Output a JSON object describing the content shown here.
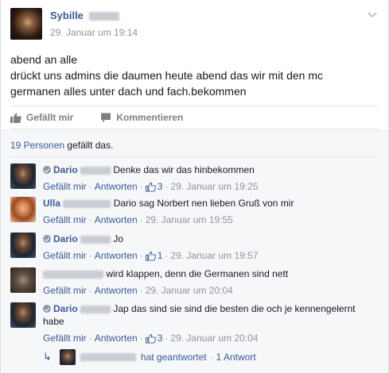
{
  "post": {
    "author_first": "Sybille",
    "time": "29. Januar um 19:14",
    "text": "abend an alle\ndrückt uns admins die daumen heute abend das wir mit den mc\ngermanen alles unter dach und fach.bekommen",
    "menu_icon": "chevron-down-icon"
  },
  "actions": {
    "like_label": "Gefällt mir",
    "comment_label": "Kommentieren"
  },
  "likes": {
    "count_link": "19 Personen",
    "suffix": " gefällt das."
  },
  "meta_labels": {
    "like": "Gefällt mir",
    "reply": "Antworten"
  },
  "comments": [
    {
      "name": "Dario",
      "moderator": true,
      "text": "Denke das wir das hinbekommen",
      "likes": "3",
      "time": "29. Januar um 19:25"
    },
    {
      "name": "Ulla",
      "moderator": false,
      "text": "Dario sag Norbert nen lieben Gruß von mir",
      "likes": "",
      "time": "29. Januar um 19:55"
    },
    {
      "name": "Dario",
      "moderator": true,
      "text": "Jo",
      "likes": "1",
      "time": "29. Januar um 19:57"
    },
    {
      "name": "",
      "moderator": false,
      "text": "wird klappen, denn die Germanen sind nett",
      "likes": "",
      "time": "29. Januar um 20:04"
    },
    {
      "name": "Dario",
      "moderator": true,
      "text": "Jap das sind sie sind die besten die och je kennengelernt habe",
      "likes": "3",
      "time": "29. Januar um 20:04"
    }
  ],
  "reply_summary": {
    "text": "hat geantwortet",
    "count": "1 Antwort"
  },
  "colors": {
    "link": "#3b5998",
    "muted": "#90949c",
    "ufi_bg": "#f6f7f9"
  }
}
